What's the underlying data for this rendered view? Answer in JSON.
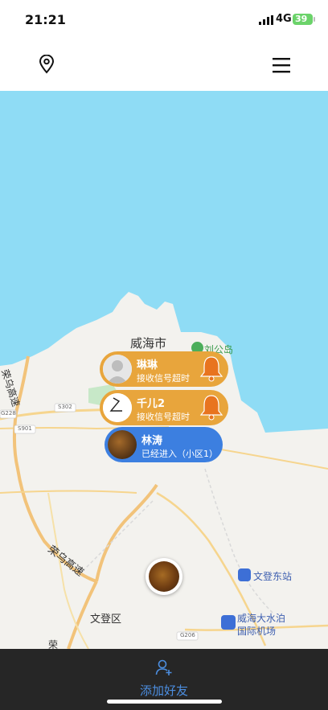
{
  "status_bar": {
    "time": "21:21",
    "network": "4G",
    "battery": "39"
  },
  "map": {
    "labels": {
      "weihai": "威海市",
      "liugong": "刘公岛",
      "rongwu1": "荣乌高速",
      "rongwu2": "荣乌高速",
      "wendeng": "文登区",
      "wendeng_east": "文登东站",
      "airport1": "威海大水泊",
      "airport2": "国际机场",
      "g228": "G228",
      "s302": "S302",
      "s901": "S901",
      "g206": "G206",
      "rong_bottom": "荣"
    }
  },
  "friends": [
    {
      "name": "琳琳",
      "status": "接收信号超时",
      "color": "#e8a53c"
    },
    {
      "name": "千儿2",
      "status": "接收信号超时",
      "color": "#e8a53c"
    },
    {
      "name": "林涛",
      "status": "已经进入（小区1）",
      "color": "#3c7fe0"
    }
  ],
  "bottom_bar": {
    "add_friend_label": "添加好友"
  },
  "icons": [
    "location-pin-icon",
    "menu-icon",
    "bell-icon",
    "add-user-icon",
    "default-avatar-icon"
  ]
}
